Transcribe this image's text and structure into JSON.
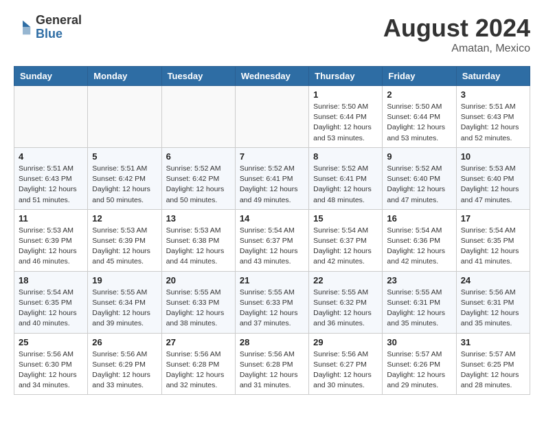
{
  "header": {
    "logo_general": "General",
    "logo_blue": "Blue",
    "month_title": "August 2024",
    "location": "Amatan, Mexico"
  },
  "days_of_week": [
    "Sunday",
    "Monday",
    "Tuesday",
    "Wednesday",
    "Thursday",
    "Friday",
    "Saturday"
  ],
  "weeks": [
    [
      {
        "day": "",
        "empty": true
      },
      {
        "day": "",
        "empty": true
      },
      {
        "day": "",
        "empty": true
      },
      {
        "day": "",
        "empty": true
      },
      {
        "day": "1",
        "sunrise": "Sunrise: 5:50 AM",
        "sunset": "Sunset: 6:44 PM",
        "daylight": "Daylight: 12 hours and 53 minutes."
      },
      {
        "day": "2",
        "sunrise": "Sunrise: 5:50 AM",
        "sunset": "Sunset: 6:44 PM",
        "daylight": "Daylight: 12 hours and 53 minutes."
      },
      {
        "day": "3",
        "sunrise": "Sunrise: 5:51 AM",
        "sunset": "Sunset: 6:43 PM",
        "daylight": "Daylight: 12 hours and 52 minutes."
      }
    ],
    [
      {
        "day": "4",
        "sunrise": "Sunrise: 5:51 AM",
        "sunset": "Sunset: 6:43 PM",
        "daylight": "Daylight: 12 hours and 51 minutes."
      },
      {
        "day": "5",
        "sunrise": "Sunrise: 5:51 AM",
        "sunset": "Sunset: 6:42 PM",
        "daylight": "Daylight: 12 hours and 50 minutes."
      },
      {
        "day": "6",
        "sunrise": "Sunrise: 5:52 AM",
        "sunset": "Sunset: 6:42 PM",
        "daylight": "Daylight: 12 hours and 50 minutes."
      },
      {
        "day": "7",
        "sunrise": "Sunrise: 5:52 AM",
        "sunset": "Sunset: 6:41 PM",
        "daylight": "Daylight: 12 hours and 49 minutes."
      },
      {
        "day": "8",
        "sunrise": "Sunrise: 5:52 AM",
        "sunset": "Sunset: 6:41 PM",
        "daylight": "Daylight: 12 hours and 48 minutes."
      },
      {
        "day": "9",
        "sunrise": "Sunrise: 5:52 AM",
        "sunset": "Sunset: 6:40 PM",
        "daylight": "Daylight: 12 hours and 47 minutes."
      },
      {
        "day": "10",
        "sunrise": "Sunrise: 5:53 AM",
        "sunset": "Sunset: 6:40 PM",
        "daylight": "Daylight: 12 hours and 47 minutes."
      }
    ],
    [
      {
        "day": "11",
        "sunrise": "Sunrise: 5:53 AM",
        "sunset": "Sunset: 6:39 PM",
        "daylight": "Daylight: 12 hours and 46 minutes."
      },
      {
        "day": "12",
        "sunrise": "Sunrise: 5:53 AM",
        "sunset": "Sunset: 6:39 PM",
        "daylight": "Daylight: 12 hours and 45 minutes."
      },
      {
        "day": "13",
        "sunrise": "Sunrise: 5:53 AM",
        "sunset": "Sunset: 6:38 PM",
        "daylight": "Daylight: 12 hours and 44 minutes."
      },
      {
        "day": "14",
        "sunrise": "Sunrise: 5:54 AM",
        "sunset": "Sunset: 6:37 PM",
        "daylight": "Daylight: 12 hours and 43 minutes."
      },
      {
        "day": "15",
        "sunrise": "Sunrise: 5:54 AM",
        "sunset": "Sunset: 6:37 PM",
        "daylight": "Daylight: 12 hours and 42 minutes."
      },
      {
        "day": "16",
        "sunrise": "Sunrise: 5:54 AM",
        "sunset": "Sunset: 6:36 PM",
        "daylight": "Daylight: 12 hours and 42 minutes."
      },
      {
        "day": "17",
        "sunrise": "Sunrise: 5:54 AM",
        "sunset": "Sunset: 6:35 PM",
        "daylight": "Daylight: 12 hours and 41 minutes."
      }
    ],
    [
      {
        "day": "18",
        "sunrise": "Sunrise: 5:54 AM",
        "sunset": "Sunset: 6:35 PM",
        "daylight": "Daylight: 12 hours and 40 minutes."
      },
      {
        "day": "19",
        "sunrise": "Sunrise: 5:55 AM",
        "sunset": "Sunset: 6:34 PM",
        "daylight": "Daylight: 12 hours and 39 minutes."
      },
      {
        "day": "20",
        "sunrise": "Sunrise: 5:55 AM",
        "sunset": "Sunset: 6:33 PM",
        "daylight": "Daylight: 12 hours and 38 minutes."
      },
      {
        "day": "21",
        "sunrise": "Sunrise: 5:55 AM",
        "sunset": "Sunset: 6:33 PM",
        "daylight": "Daylight: 12 hours and 37 minutes."
      },
      {
        "day": "22",
        "sunrise": "Sunrise: 5:55 AM",
        "sunset": "Sunset: 6:32 PM",
        "daylight": "Daylight: 12 hours and 36 minutes."
      },
      {
        "day": "23",
        "sunrise": "Sunrise: 5:55 AM",
        "sunset": "Sunset: 6:31 PM",
        "daylight": "Daylight: 12 hours and 35 minutes."
      },
      {
        "day": "24",
        "sunrise": "Sunrise: 5:56 AM",
        "sunset": "Sunset: 6:31 PM",
        "daylight": "Daylight: 12 hours and 35 minutes."
      }
    ],
    [
      {
        "day": "25",
        "sunrise": "Sunrise: 5:56 AM",
        "sunset": "Sunset: 6:30 PM",
        "daylight": "Daylight: 12 hours and 34 minutes."
      },
      {
        "day": "26",
        "sunrise": "Sunrise: 5:56 AM",
        "sunset": "Sunset: 6:29 PM",
        "daylight": "Daylight: 12 hours and 33 minutes."
      },
      {
        "day": "27",
        "sunrise": "Sunrise: 5:56 AM",
        "sunset": "Sunset: 6:28 PM",
        "daylight": "Daylight: 12 hours and 32 minutes."
      },
      {
        "day": "28",
        "sunrise": "Sunrise: 5:56 AM",
        "sunset": "Sunset: 6:28 PM",
        "daylight": "Daylight: 12 hours and 31 minutes."
      },
      {
        "day": "29",
        "sunrise": "Sunrise: 5:56 AM",
        "sunset": "Sunset: 6:27 PM",
        "daylight": "Daylight: 12 hours and 30 minutes."
      },
      {
        "day": "30",
        "sunrise": "Sunrise: 5:57 AM",
        "sunset": "Sunset: 6:26 PM",
        "daylight": "Daylight: 12 hours and 29 minutes."
      },
      {
        "day": "31",
        "sunrise": "Sunrise: 5:57 AM",
        "sunset": "Sunset: 6:25 PM",
        "daylight": "Daylight: 12 hours and 28 minutes."
      }
    ]
  ]
}
